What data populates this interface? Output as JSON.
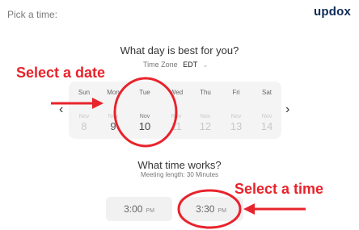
{
  "header": {
    "pick_label": "Pick a time:",
    "logo_text": "updox"
  },
  "calendar": {
    "question": "What day is best for you?",
    "tz_label": "Time Zone",
    "tz_value": "EDT",
    "days": [
      {
        "name": "Sun",
        "month": "Nov",
        "num": "8"
      },
      {
        "name": "Mon",
        "month": "Nov",
        "num": "9"
      },
      {
        "name": "Tue",
        "month": "Nov",
        "num": "10"
      },
      {
        "name": "Wed",
        "month": "Nov",
        "num": "11"
      },
      {
        "name": "Thu",
        "month": "Nov",
        "num": "12"
      },
      {
        "name": "Fri",
        "month": "Nov",
        "num": "13"
      },
      {
        "name": "Sat",
        "month": "Nov",
        "num": "14"
      }
    ],
    "prev_icon": "‹",
    "next_icon": "›"
  },
  "times": {
    "question": "What time works?",
    "meeting_length": "Meeting length: 30 Minutes",
    "slots": [
      {
        "time": "3:00",
        "ampm": "PM"
      },
      {
        "time": "3:30",
        "ampm": "PM"
      }
    ]
  },
  "annotations": {
    "select_date": "Select a date",
    "select_time": "Select a time",
    "accent_color": "#e8232b"
  }
}
